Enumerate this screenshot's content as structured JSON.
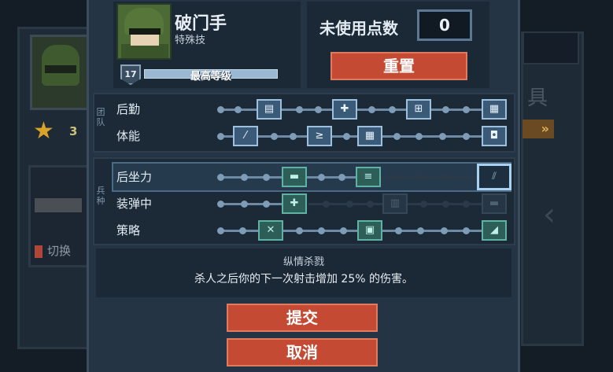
{
  "background": {
    "level": "3",
    "switch_label": "切换",
    "right_text": "具",
    "right_arrow": "»"
  },
  "character": {
    "name": "破门手",
    "subtitle": "特殊技",
    "level": "17",
    "level_text": "最高等级"
  },
  "points": {
    "label": "未使用点数",
    "value": "0",
    "reset_label": "重置"
  },
  "groups": [
    {
      "tag": "团队"
    },
    {
      "tag": "兵种"
    }
  ],
  "rows": [
    {
      "label": "后勤"
    },
    {
      "label": "体能"
    },
    {
      "label": "后坐力"
    },
    {
      "label": "装弹中"
    },
    {
      "label": "策略"
    }
  ],
  "description": {
    "title": "纵情杀戮",
    "text": "杀人之后你的下一次射击增加 25% 的伤害。"
  },
  "buttons": {
    "submit": "提交",
    "cancel": "取消"
  },
  "colors": {
    "accent_red": "#c44a34",
    "node_blue": "#3a5a78",
    "node_teal": "#2e5e58"
  }
}
